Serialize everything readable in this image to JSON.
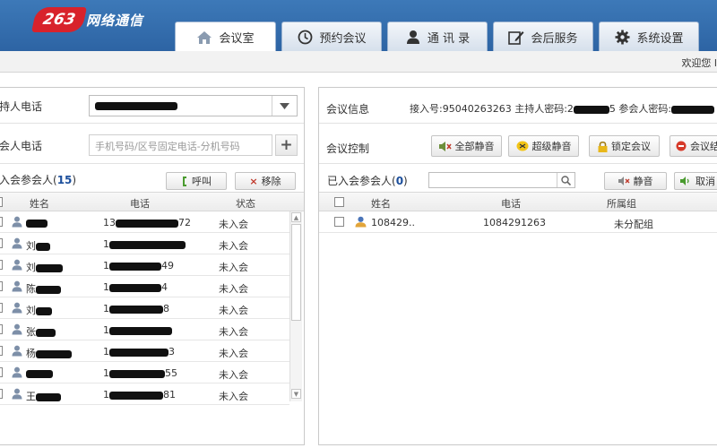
{
  "logo": {
    "mark": "263",
    "text": "网络通信"
  },
  "tabs": [
    {
      "label": "会议室",
      "icon": "home-icon",
      "active": true
    },
    {
      "label": "预约会议",
      "icon": "clock-icon",
      "active": false
    },
    {
      "label": "通 讯 录",
      "icon": "person-icon",
      "active": false
    },
    {
      "label": "会后服务",
      "icon": "edit-icon",
      "active": false
    },
    {
      "label": "系统设置",
      "icon": "gear-icon",
      "active": false
    }
  ],
  "statusbar": {
    "welcome": "欢迎您 l"
  },
  "left": {
    "host_phone_label": "持人电话",
    "host_phone_value": "",
    "add_phone_label": "会人电话",
    "add_phone_placeholder": "手机号码/区号固定电话-分机号码",
    "participants_title": "入会参会人(",
    "participants_count": "15",
    "participants_close": ")",
    "call_button": "呼叫",
    "remove_button": "移除",
    "columns": {
      "name": "姓名",
      "phone": "电话",
      "status": "状态"
    },
    "rows": [
      {
        "name_visible": "",
        "phone_prefix": "13",
        "phone_suffix": "72",
        "status": "未入会"
      },
      {
        "name_visible": "刘",
        "phone_prefix": "1",
        "phone_suffix": "",
        "status": "未入会"
      },
      {
        "name_visible": "刘",
        "phone_prefix": "1",
        "phone_suffix": "49",
        "status": "未入会"
      },
      {
        "name_visible": "陈",
        "phone_prefix": "1",
        "phone_suffix": "4",
        "status": "未入会"
      },
      {
        "name_visible": "刘",
        "phone_prefix": "1",
        "phone_suffix": "8",
        "status": "未入会"
      },
      {
        "name_visible": "张",
        "phone_prefix": "1",
        "phone_suffix": "",
        "status": "未入会"
      },
      {
        "name_visible": "杨",
        "phone_prefix": "1",
        "phone_suffix": "3",
        "status": "未入会"
      },
      {
        "name_visible": "",
        "phone_prefix": "1",
        "phone_suffix": "55",
        "status": "未入会"
      },
      {
        "name_visible": "王",
        "phone_prefix": "1",
        "phone_suffix": "81",
        "status": "未入会"
      }
    ]
  },
  "right": {
    "meeting_info_label": "会议信息",
    "access_number_text": "接入号:95040263263",
    "host_password_text": "主持人密码:2",
    "host_password_tail": "5",
    "participant_password_text": "参会人密码:",
    "control_label": "会议控制",
    "mute_all": "全部静音",
    "super_mute": "超级静音",
    "lock_meeting": "锁定会议",
    "end_meeting": "会议结",
    "joined_title": "已入会参会人(",
    "joined_count": "0",
    "joined_close": ")",
    "search_value": "",
    "mute_button": "静音",
    "unmute_button": "取消",
    "columns": {
      "name": "姓名",
      "phone": "电话",
      "group": "所属组"
    },
    "rows": [
      {
        "name": "108429..",
        "phone": "1084291263",
        "group": "未分配组"
      }
    ]
  },
  "colors": {
    "header": "#2d64a4",
    "accent_blue": "#1c4f9c",
    "logo_red": "#d8222b"
  }
}
